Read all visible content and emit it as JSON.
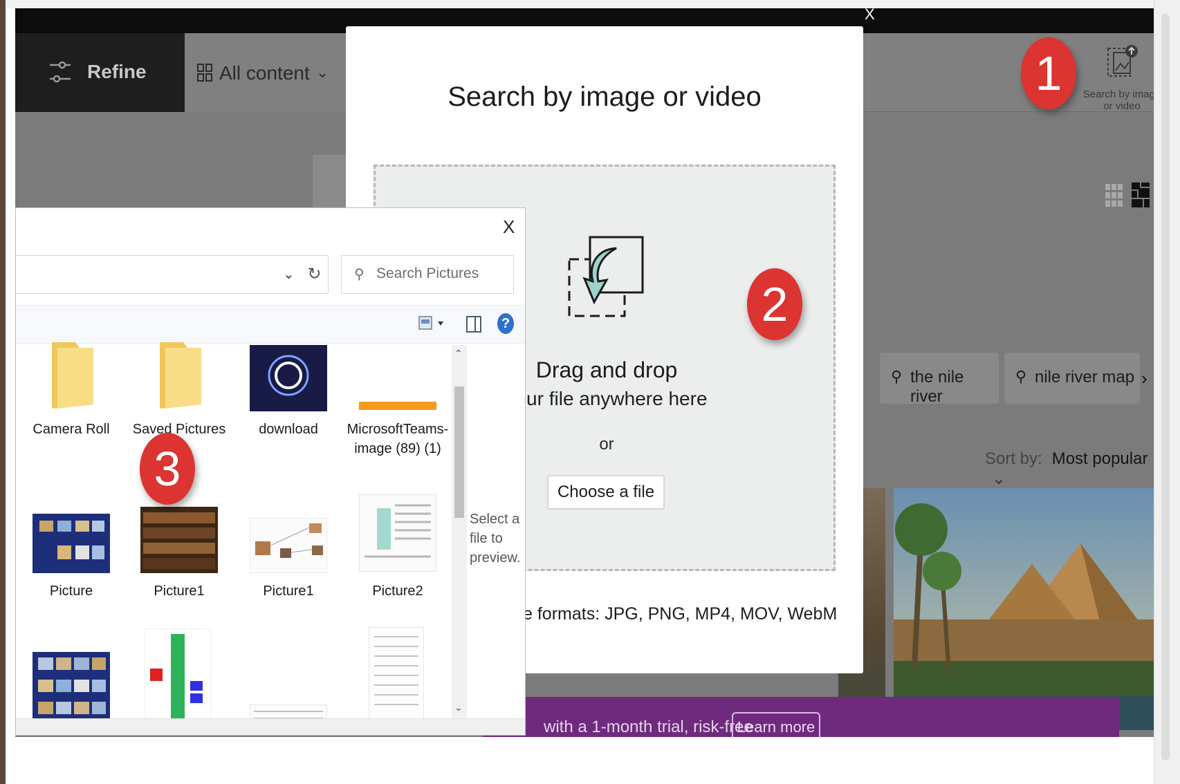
{
  "window": {
    "top_close_label": "X"
  },
  "header": {
    "refine_label": "Refine",
    "all_content_label": "All content",
    "search_by_image_label": "Search by image or video"
  },
  "chips": [
    {
      "label": "the nile river",
      "icon": "search-icon"
    },
    {
      "label": "nile river map",
      "icon": "search-icon"
    }
  ],
  "sort": {
    "label": "Sort by:",
    "value": "Most popular"
  },
  "banner": {
    "text": "with a 1-month trial, risk-free",
    "button_label": "Learn more"
  },
  "modal": {
    "title": "Search by image or video",
    "drop_title": "Drag and drop",
    "drop_subtitle": "your file anywhere here",
    "or_label": "or",
    "choose_label": "Choose a file",
    "formats_text": "e formats: JPG, PNG, MP4, MOV, WebM"
  },
  "badges": {
    "one": "1",
    "two": "2",
    "three": "3"
  },
  "file_dialog": {
    "close_label": "X",
    "search_placeholder": "Search Pictures",
    "preview_text": "Select a file to preview.",
    "files": [
      {
        "name": "Camera Roll",
        "kind": "folder"
      },
      {
        "name": "Saved Pictures",
        "kind": "folder"
      },
      {
        "name": "download",
        "kind": "image"
      },
      {
        "name": "MicrosoftTeams-image (89) (1)",
        "kind": "image"
      },
      {
        "name": "Picture",
        "kind": "image"
      },
      {
        "name": "Picture1",
        "kind": "image"
      },
      {
        "name": "Picture1",
        "kind": "image"
      },
      {
        "name": "Picture2",
        "kind": "image"
      }
    ]
  },
  "colors": {
    "badge": "#dc3431",
    "banner": "#6f2a7e",
    "help": "#2f6fcf"
  }
}
